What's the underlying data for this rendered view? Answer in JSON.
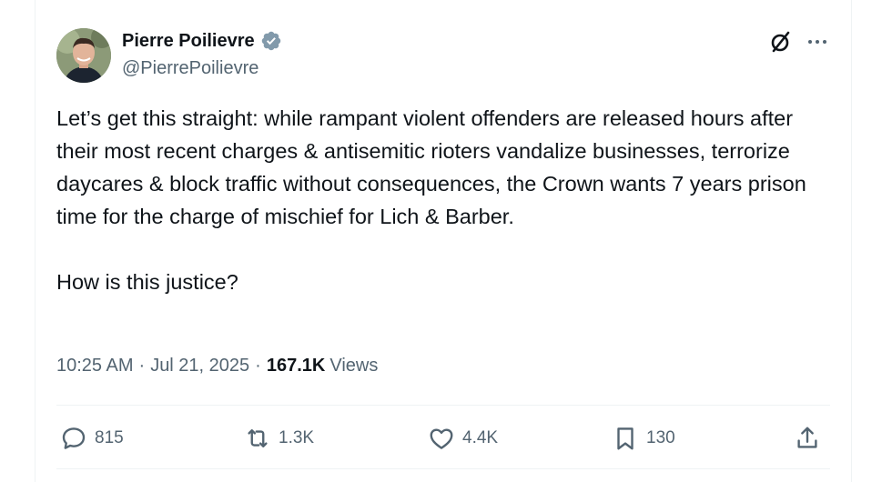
{
  "author": {
    "name": "Pierre Poilievre",
    "handle": "@PierrePoilievre",
    "verified": true
  },
  "tweet": {
    "text": "Let’s get this straight: while rampant violent offenders are released hours after their most recent charges & antisemitic rioters vandalize businesses, terrorize daycares & block traffic without consequences, the Crown wants 7 years prison time for the charge of mischief for Lich & Barber.\n\nHow is this justice?",
    "time": "10:25 AM",
    "date": "Jul 21, 2025",
    "views_count": "167.1K",
    "views_label": "Views"
  },
  "actions": {
    "replies": "815",
    "reposts": "1.3K",
    "likes": "4.4K",
    "bookmarks": "130"
  },
  "icons": [
    "grok-icon",
    "more-icon",
    "verified-icon",
    "reply-icon",
    "repost-icon",
    "like-icon",
    "bookmark-icon",
    "share-icon"
  ],
  "colors": {
    "text_primary": "#0f1419",
    "text_secondary": "#536471",
    "divider": "#eff3f4",
    "verified_badge": "#829aab"
  }
}
